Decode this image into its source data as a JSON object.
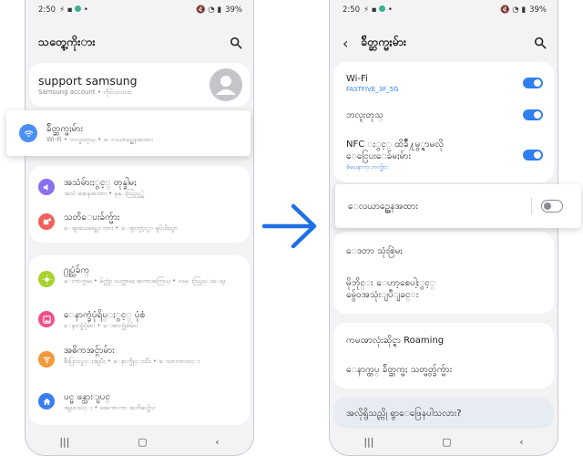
{
  "status": {
    "time": "2:50",
    "battery": "39%"
  },
  "left": {
    "header_title": "သတ္တွေ့ကိုးား",
    "account": {
      "name": "support samsung",
      "subtitle": "Samsung account  •  ကိုင်ပဘးပးး"
    },
    "highlight": {
      "title": "ခ်ိတ္ဆက္မႈမ်ား",
      "subtitle": "Wi-Fi  •  ဘလူးတုသ္  •  ေလယာဥ္အေနအထား"
    },
    "group1": [
      {
        "title": "အသံမ်ားႏွင့္ တုန္ခါမႈ",
        "subtitle": "အသံ အေနအထား  •  မုန္းသြည့္ထဲ"
      },
      {
        "title": "သတိေပးခ်က္မ်ား",
        "subtitle": "ေအွးသေရေပွး ဘား  •  ေအွးဘွာ့ႏွာ မူပ်ပါးသွာ"
      }
    ],
    "group2": [
      {
        "title": "႐ုပ္သံခ်က္",
        "subtitle": "ေတာက္ပမႈ  •  မ်က္လုံး သက္သာမႈ အကာအကြယ္  •  လမ္းသြည္းေရး"
      },
      {
        "title": "ေနာက္ခံပုံရိပ္ႏွင့္ ပုံစံ",
        "subtitle": "ေနာက္ခံပုံမ်ား  •  ေအာက္ပုံစံမ်ား"
      },
      {
        "title": "အဓိကအင္ဂ်ာမ်ား",
        "subtitle": "စီးပြားလွင္းအျပီး  •  ေနာက္ပိုင္းသီး  •  ေသာကာထင္း"
      },
      {
        "title": "ပင္မ ဖန္သားျပင္",
        "subtitle": "အျပာသင္း  •  အေကာကာ အဘိဆင္မ်ား"
      }
    ]
  },
  "right": {
    "header_title": "ခ်ိတ္ဆက္မႈမ်ား",
    "group1": [
      {
        "title": "Wi-Fi",
        "subtitle": "FASTFIVE_3F_5G"
      },
      {
        "title": "ဘလူးတုသ္",
        "subtitle": ""
      },
      {
        "title": "NFC ႏွင့္ ထိခ်ိဳ႔မွ္ရာမလို",
        "title2": "ေငြေပးေခ်မႈမ်ား",
        "subtitle": "စံပေနာက္ ဘက္မ်ား"
      }
    ],
    "highlight": {
      "title": "ေလယာဥ္အေနအထား"
    },
    "group2": [
      {
        "title": "ေဒတာ သုံးစြဲမႈ"
      },
      {
        "title": "မိုဘိုင္း ေဟာ့စေပါ့ႏွင့္",
        "title2": "မွ်ေဝအသုံးျပဳျခင္း"
      }
    ],
    "group3": [
      {
        "title": "ကမၻာလုံးဆိုင္ရာ Roaming"
      },
      {
        "title": "ေနာက္ထပ္ ခ်ိတ္ဆက္မႈ သတ္မွတ္ခ်က္မ်ား"
      }
    ],
    "suggestion": "အလိုရွိသည္ကို ရွာေဖြေနပါသလား?"
  },
  "colors": {
    "accent": "#2f7ff0",
    "arrow": "#1f6fe6",
    "wifi_icon": "#4a8ff5"
  },
  "icons": [
    "search-icon",
    "back-icon",
    "wifi-icon",
    "sound-icon",
    "notification-icon",
    "display-icon",
    "wallpaper-icon",
    "advanced-features-icon",
    "home-screen-icon",
    "avatar-icon"
  ]
}
